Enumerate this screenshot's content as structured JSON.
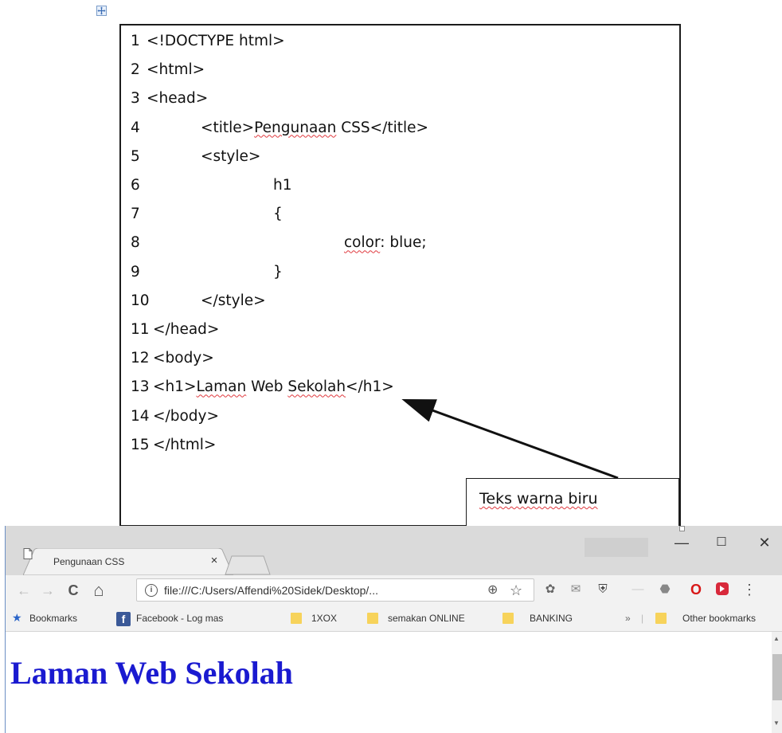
{
  "document": {
    "code_lines": [
      {
        "num": "1",
        "code": "<!DOCTYPE html>"
      },
      {
        "num": "2",
        "code": "<html>"
      },
      {
        "num": "3",
        "code": "<head>"
      },
      {
        "num": "4",
        "pre": "<title>",
        "squig": "Pengunaan",
        "post": " CSS</title>"
      },
      {
        "num": "5",
        "code": "<style>"
      },
      {
        "num": "6",
        "code": "h1"
      },
      {
        "num": "7",
        "code": "{"
      },
      {
        "num": "8",
        "squig": "color",
        "post": ": blue;"
      },
      {
        "num": "9",
        "code": "}"
      },
      {
        "num": "10",
        "code": "</style>"
      },
      {
        "num": "11",
        "code": "</head>"
      },
      {
        "num": "12",
        "code": "<body>"
      },
      {
        "num": "13",
        "pre": "<h1>",
        "squig": "Laman",
        "mid": " Web ",
        "squig2": "Sekolah",
        "post": "</h1>"
      },
      {
        "num": "14",
        "code": "</body>"
      },
      {
        "num": "15",
        "code": "</html>"
      }
    ],
    "callout_text": "Teks warna biru"
  },
  "browser": {
    "tab_title": "Pengunaan CSS",
    "tab_close": "×",
    "window_buttons": {
      "minimize": "—",
      "maximize": "☐",
      "close": "✕"
    },
    "nav": {
      "back": "←",
      "forward": "→",
      "reload": "C",
      "home": "⌂"
    },
    "url": "file:///C:/Users/Affendi%20Sidek/Desktop/...",
    "info_icon": "i",
    "zoom_icon": "⊕",
    "star_icon": "☆",
    "menu_icon": "⋮",
    "bookmarks": {
      "label": "Bookmarks",
      "items": [
        "Facebook - Log mas",
        "1XOX",
        "semakan ONLINE",
        "BANKING"
      ],
      "overflow": "»",
      "other": "Other bookmarks"
    },
    "page_heading": "Laman Web Sekolah",
    "accent_color": "#1a1ad0"
  }
}
